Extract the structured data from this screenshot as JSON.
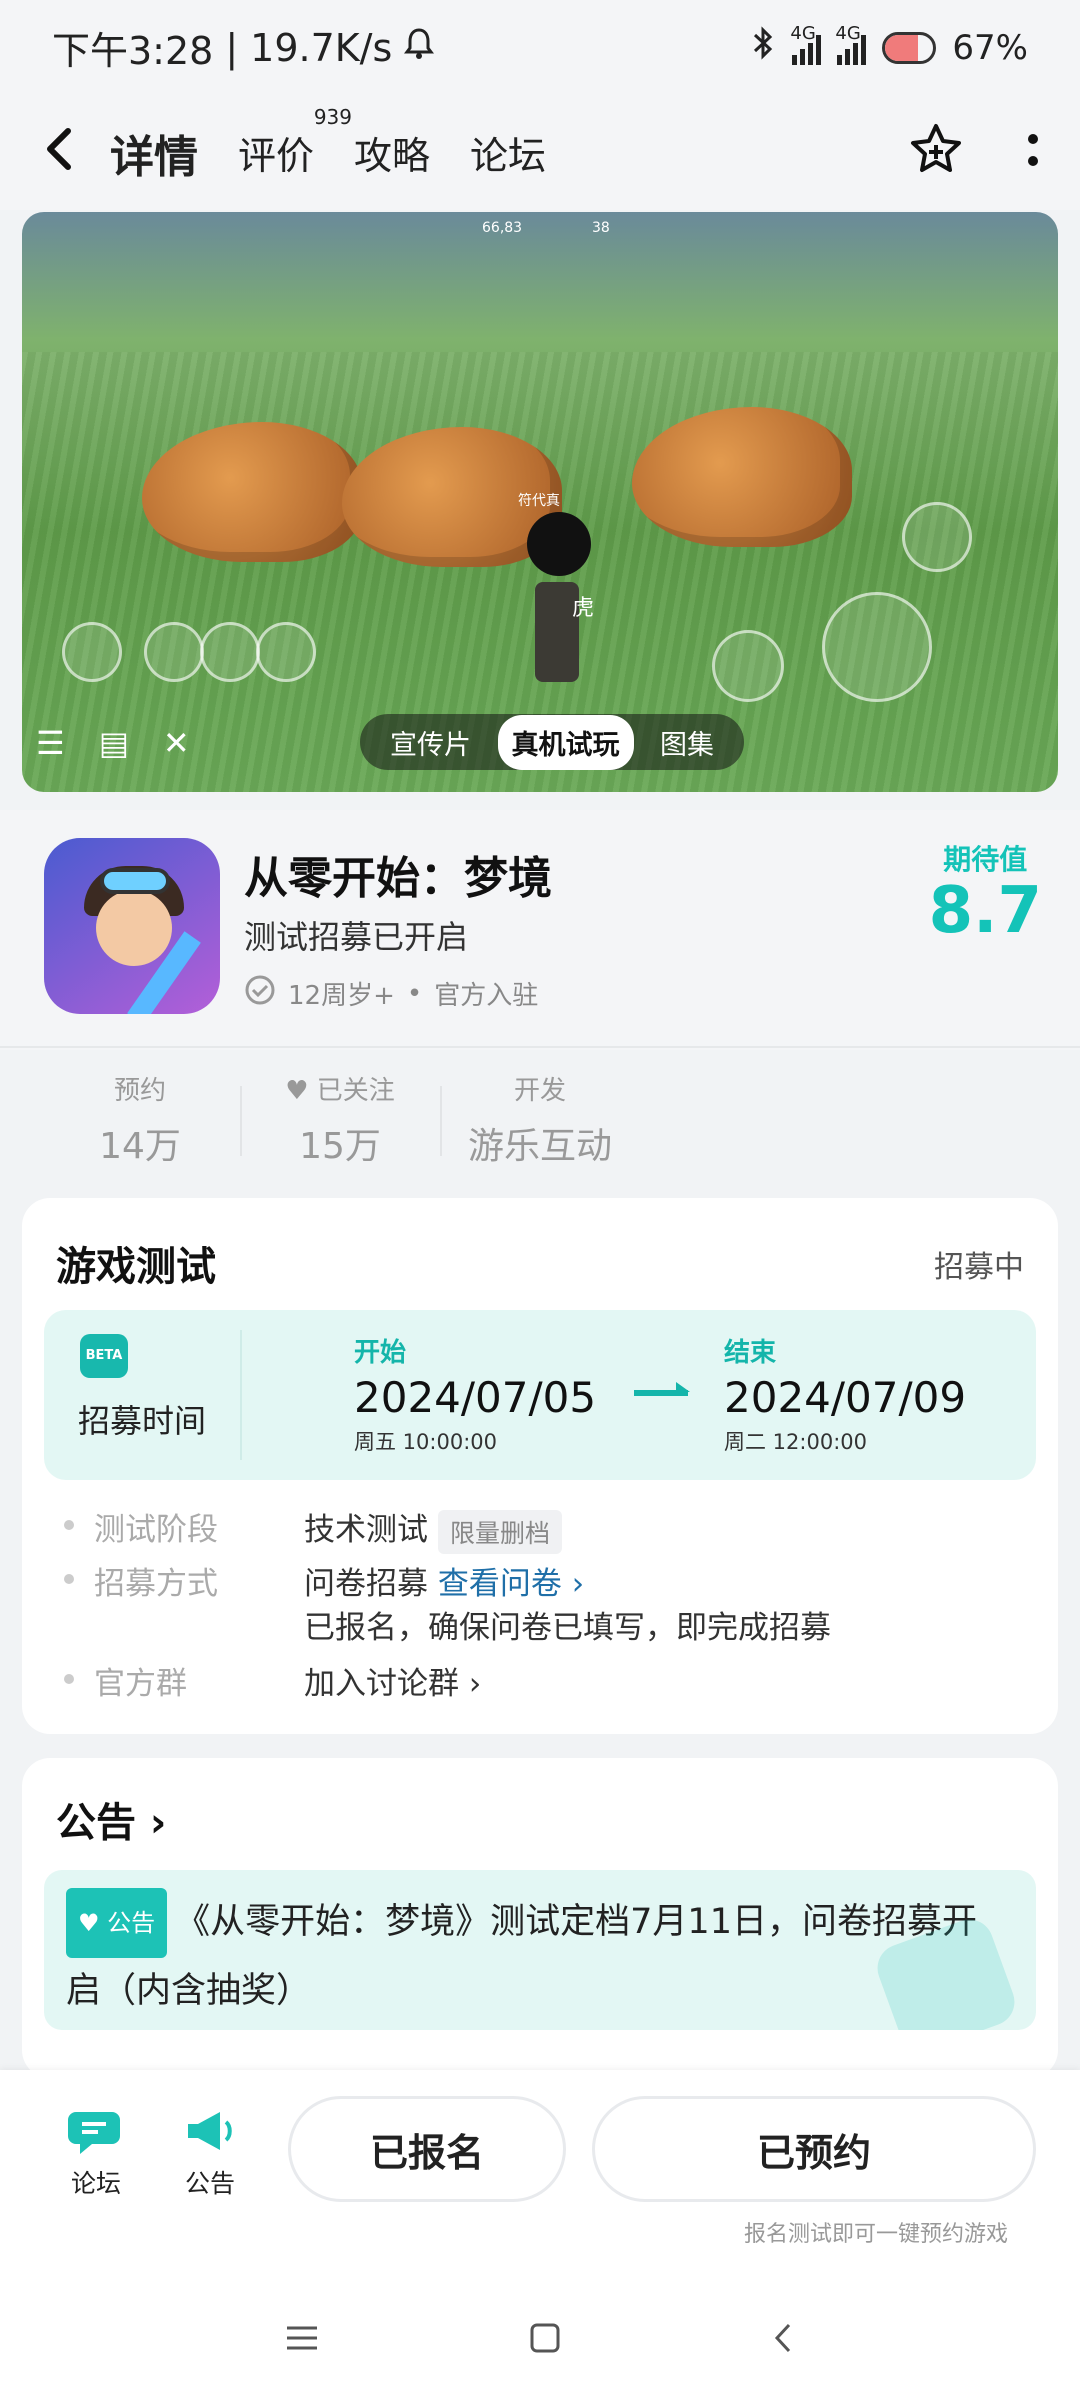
{
  "status_bar": {
    "time": "下午3:28",
    "net_speed": "19.7K/s",
    "sig1": "4G",
    "sig2": "4G",
    "battery": "67%",
    "battery_level": 0.67
  },
  "nav": {
    "tabs": [
      {
        "label": "详情",
        "active": true
      },
      {
        "label": "评价",
        "count": "939"
      },
      {
        "label": "攻略"
      },
      {
        "label": "论坛"
      }
    ]
  },
  "media": {
    "hud_coords": "66,83",
    "hud_number": "38",
    "hud_name": "虎",
    "hud_player": "符代真",
    "tabs": [
      "宣传片",
      "真机试玩",
      "图集"
    ],
    "selected_tab": "真机试玩"
  },
  "game": {
    "title": "从零开始：梦境",
    "subtitle": "测试招募已开启",
    "age": "12周岁+",
    "separator": "•",
    "official": "官方入驻",
    "expect_label": "期待值",
    "expect_value": "8.7"
  },
  "stats": [
    {
      "key": "预约",
      "value": "14万"
    },
    {
      "key": "已关注",
      "value": "15万"
    },
    {
      "key": "开发",
      "value": "游乐互动"
    }
  ],
  "test": {
    "title": "游戏测试",
    "status": "招募中",
    "beta_icon": "BETA",
    "time_label": "招募时间",
    "start_label": "开始",
    "start_date": "2024/07/05",
    "start_sub": "周五  10:00:00",
    "end_label": "结束",
    "end_date": "2024/07/09",
    "end_sub": "周二  12:00:00",
    "rows": [
      {
        "key": "测试阶段",
        "value": "技术测试",
        "tag": "限量删档"
      },
      {
        "key": "招募方式",
        "value": "问卷招募",
        "link": "查看问卷 ›",
        "extra": "已报名，确保问卷已填写，即完成招募"
      },
      {
        "key": "官方群",
        "link": "加入讨论群 ›"
      }
    ]
  },
  "notice": {
    "title": "公告 ›",
    "badge": "公告",
    "text": "《从零开始：梦境》测试定档7月11日，问卷招募开启（内含抽奖）"
  },
  "bottom": {
    "forum_label": "论坛",
    "notice_label": "公告",
    "signed_label": "已报名",
    "reserved_label": "已预约",
    "hint": "报名测试即可一键预约游戏"
  },
  "colors": {
    "accent": "#14c3b8",
    "link": "#1f6fa8"
  }
}
